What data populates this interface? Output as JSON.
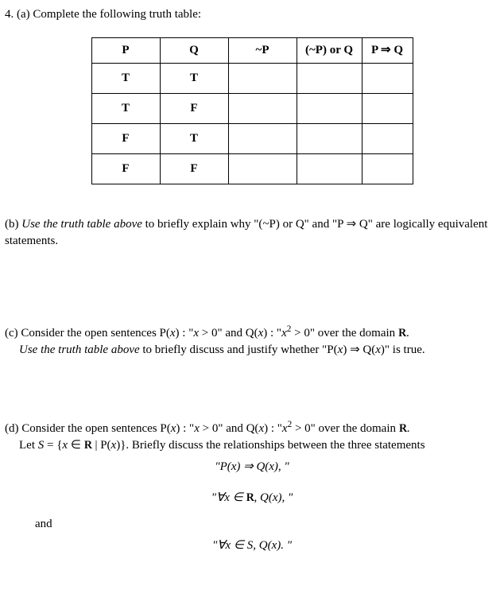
{
  "problem_number": "4.",
  "part_a": {
    "label": "(a)",
    "text": "Complete the following truth table:"
  },
  "table": {
    "headers": {
      "p": "P",
      "q": "Q",
      "not_p": "~P",
      "or": "(~P) or Q",
      "imp": "P ⇒ Q"
    },
    "rows": [
      {
        "p": "T",
        "q": "T",
        "not_p": "",
        "or": "",
        "imp": ""
      },
      {
        "p": "T",
        "q": "F",
        "not_p": "",
        "or": "",
        "imp": ""
      },
      {
        "p": "F",
        "q": "T",
        "not_p": "",
        "or": "",
        "imp": ""
      },
      {
        "p": "F",
        "q": "F",
        "not_p": "",
        "or": "",
        "imp": ""
      }
    ]
  },
  "part_b": {
    "label": "(b)",
    "lead_italic": "Use the truth table above",
    "rest": " to briefly explain why \"(~P) or Q\" and \"P ⇒ Q\" are logically equivalent statements."
  },
  "part_c": {
    "label": "(c)",
    "line1_a": "Consider the open sentences P(",
    "line1_b": ") : \"",
    "line1_c": " > 0\" and Q(",
    "line1_d": ") : \"",
    "line1_e": " > 0\" over the domain ",
    "line1_f": ".",
    "x": "x",
    "sq": "2",
    "line2_italic": "Use the truth table above",
    "line2_rest": " to briefly discuss and justify whether \"P(",
    "line2_mid": ") ⇒ Q(",
    "line2_end": ")\" is true."
  },
  "part_d": {
    "label": "(d)",
    "line1_a": "Consider the open sentences P(",
    "line1_b": ") : \"",
    "line1_c": " > 0\" and Q(",
    "line1_d": ") : \"",
    "line1_e": " > 0\" over the domain ",
    "line1_f": ".",
    "x": "x",
    "sq": "2",
    "line2_a": "Let ",
    "line2_S": "S",
    "line2_eq": "  =  {",
    "line2_in": " ∈  ",
    "line2_bar": " | P(",
    "line2_close": ")}. Briefly discuss the relationships between the three statements",
    "stmt1": "\"P(x) ⇒ Q(x), \"",
    "stmt2_a": "\"∀",
    "stmt2_b": " ∈ ",
    "stmt2_c": ", Q(",
    "stmt2_d": "), \"",
    "and": "and",
    "stmt3_a": "\"∀",
    "stmt3_b": " ∈ ",
    "stmt3_S": "S",
    "stmt3_c": ", Q(",
    "stmt3_d": "). \""
  }
}
